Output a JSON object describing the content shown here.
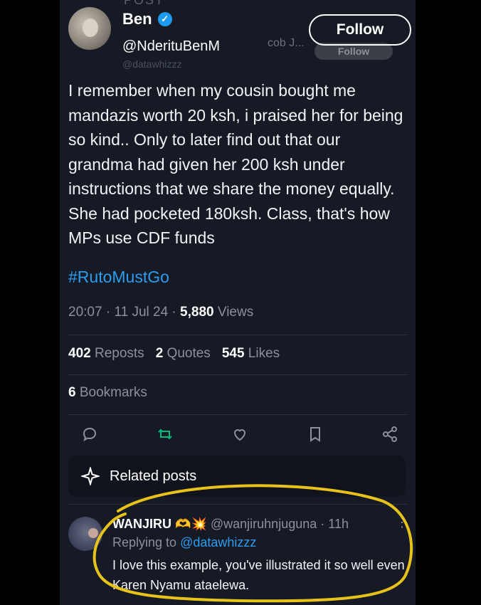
{
  "header": {
    "top_partial": "POST",
    "name": "Ben",
    "handle": "@NderituBenM",
    "ghost_handle": "cob J...",
    "ghost_handle2": "@datawhizzz",
    "follow_label": "Follow",
    "follow_ghost_label": "Follow"
  },
  "tweet": {
    "text": "I remember when my cousin bought me mandazis worth 20 ksh, i praised her for being so kind.. Only to later find out that our grandma had given her 200 ksh under instructions that we share the money equally. She had pocketed 180ksh. Class, that's how MPs use CDF funds",
    "hashtag": "#RutoMustGo",
    "time": "20:07",
    "date": "11 Jul 24",
    "views_count": "5,880",
    "views_label": "Views"
  },
  "stats": {
    "reposts_count": "402",
    "reposts_label": "Reposts",
    "quotes_count": "2",
    "quotes_label": "Quotes",
    "likes_count": "545",
    "likes_label": "Likes",
    "bookmarks_count": "6",
    "bookmarks_label": "Bookmarks"
  },
  "related": {
    "label": "Related posts"
  },
  "reply": {
    "name": "WANJIRU",
    "emoji": "🫶💥",
    "handle": "@wanjiruhnjuguna",
    "sep": "·",
    "time": "11h",
    "more": "⋮",
    "replying_prefix": "Replying to",
    "replying_to": "@datawhizzz",
    "text": "I love this example, you've illustrated it so well even Karen Nyamu ataelewa."
  },
  "colors": {
    "background": "#161a24",
    "accent_blue": "#1d9bf0",
    "repost_green": "#00ba7c",
    "highlight_yellow": "#e6c21a"
  },
  "icons": [
    "verified-icon",
    "reply-icon",
    "repost-icon",
    "like-icon",
    "bookmark-icon",
    "share-icon",
    "sparkle-icon"
  ]
}
